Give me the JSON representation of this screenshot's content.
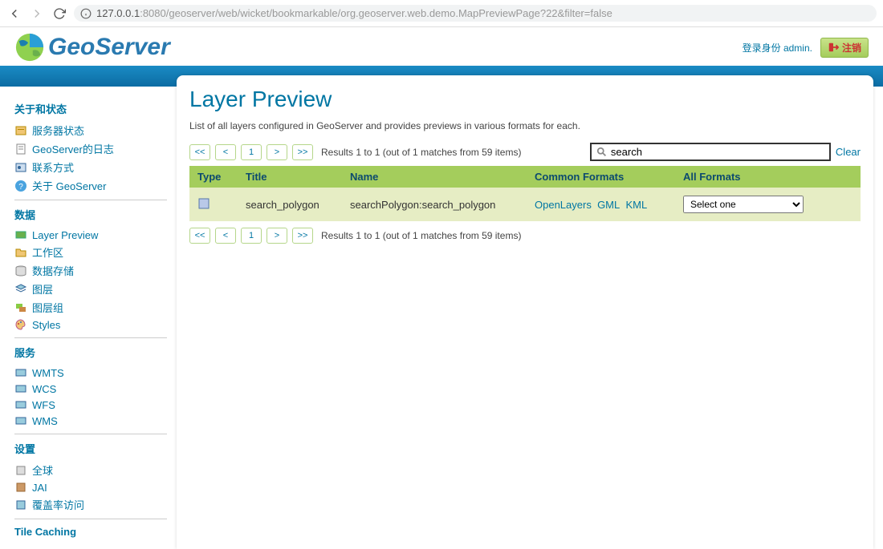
{
  "browser": {
    "url_prefix": "127.0.0.1",
    "url_port": ":8080",
    "url_path": "/geoserver/web/wicket/bookmarkable/org.geoserver.web.demo.MapPreviewPage?22&filter=false"
  },
  "header": {
    "brand": "GeoServer",
    "login_prefix": "登录身份",
    "login_user": "admin.",
    "logout": "注销"
  },
  "sidebar": {
    "sections": [
      {
        "title": "关于和状态",
        "items": [
          {
            "label": "服务器状态"
          },
          {
            "label": "GeoServer的日志"
          },
          {
            "label": "联系方式"
          },
          {
            "label": "关于 GeoServer"
          }
        ]
      },
      {
        "title": "数据",
        "items": [
          {
            "label": "Layer Preview"
          },
          {
            "label": "工作区"
          },
          {
            "label": "数据存储"
          },
          {
            "label": "图层"
          },
          {
            "label": "图层组"
          },
          {
            "label": "Styles"
          }
        ]
      },
      {
        "title": "服务",
        "items": [
          {
            "label": "WMTS"
          },
          {
            "label": "WCS"
          },
          {
            "label": "WFS"
          },
          {
            "label": "WMS"
          }
        ]
      },
      {
        "title": "设置",
        "items": [
          {
            "label": "全球"
          },
          {
            "label": "JAI"
          },
          {
            "label": "覆盖率访问"
          }
        ]
      },
      {
        "title": "Tile Caching",
        "items": []
      }
    ]
  },
  "main": {
    "title": "Layer Preview",
    "description": "List of all layers configured in GeoServer and provides previews in various formats for each.",
    "pager": {
      "first": "<<",
      "prev": "<",
      "page": "1",
      "next": ">",
      "last": ">>",
      "info": "Results 1 to 1 (out of 1 matches from 59 items)"
    },
    "search": {
      "value": "search",
      "clear": "Clear"
    },
    "columns": {
      "type": "Type",
      "title": "Title",
      "name": "Name",
      "common": "Common Formats",
      "all": "All Formats"
    },
    "rows": [
      {
        "title": "search_polygon",
        "name": "searchPolygon:search_polygon",
        "links": {
          "ol": "OpenLayers",
          "gml": "GML",
          "kml": "KML"
        },
        "select": "Select one"
      }
    ]
  }
}
